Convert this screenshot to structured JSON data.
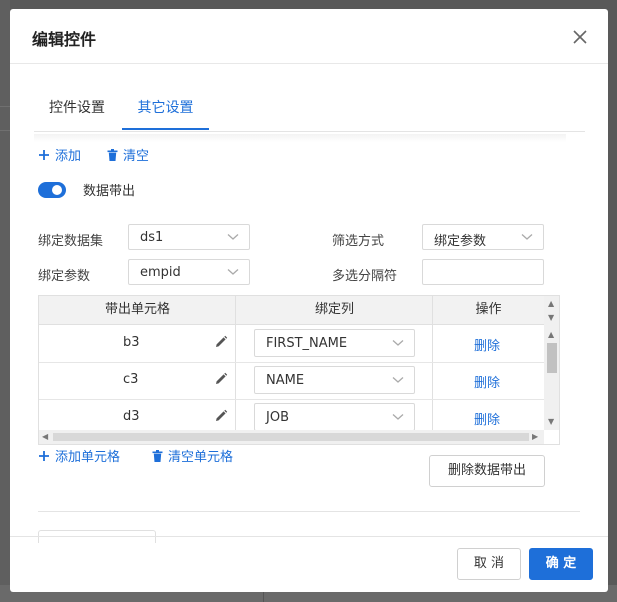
{
  "dialog": {
    "title": "编辑控件",
    "close_icon": "close-icon"
  },
  "tabs": [
    {
      "label": "控件设置",
      "active": false
    },
    {
      "label": "其它设置",
      "active": true
    }
  ],
  "toolbar": {
    "add_label": "添加",
    "clear_label": "清空"
  },
  "data_export": {
    "label": "数据带出",
    "enabled": true
  },
  "form": {
    "dataset_label": "绑定数据集",
    "dataset_value": "ds1",
    "filter_label": "筛选方式",
    "filter_value": "绑定参数",
    "param_label": "绑定参数",
    "param_value": "empid",
    "separator_label": "多选分隔符",
    "separator_value": ""
  },
  "table": {
    "headers": [
      "带出单元格",
      "绑定列",
      "操作"
    ],
    "rows": [
      {
        "cell": "b3",
        "column": "FIRST_NAME",
        "action": "删除"
      },
      {
        "cell": "c3",
        "column": "NAME",
        "action": "删除"
      },
      {
        "cell": "d3",
        "column": "JOB",
        "action": "删除"
      }
    ]
  },
  "table_actions": {
    "add_cell_label": "添加单元格",
    "clear_cell_label": "清空单元格",
    "delete_export_label": "删除数据带出"
  },
  "footer": {
    "cancel_label": "取 消",
    "confirm_label": "确 定"
  },
  "colors": {
    "accent": "#1e6fd9",
    "overlay": "#595959"
  }
}
